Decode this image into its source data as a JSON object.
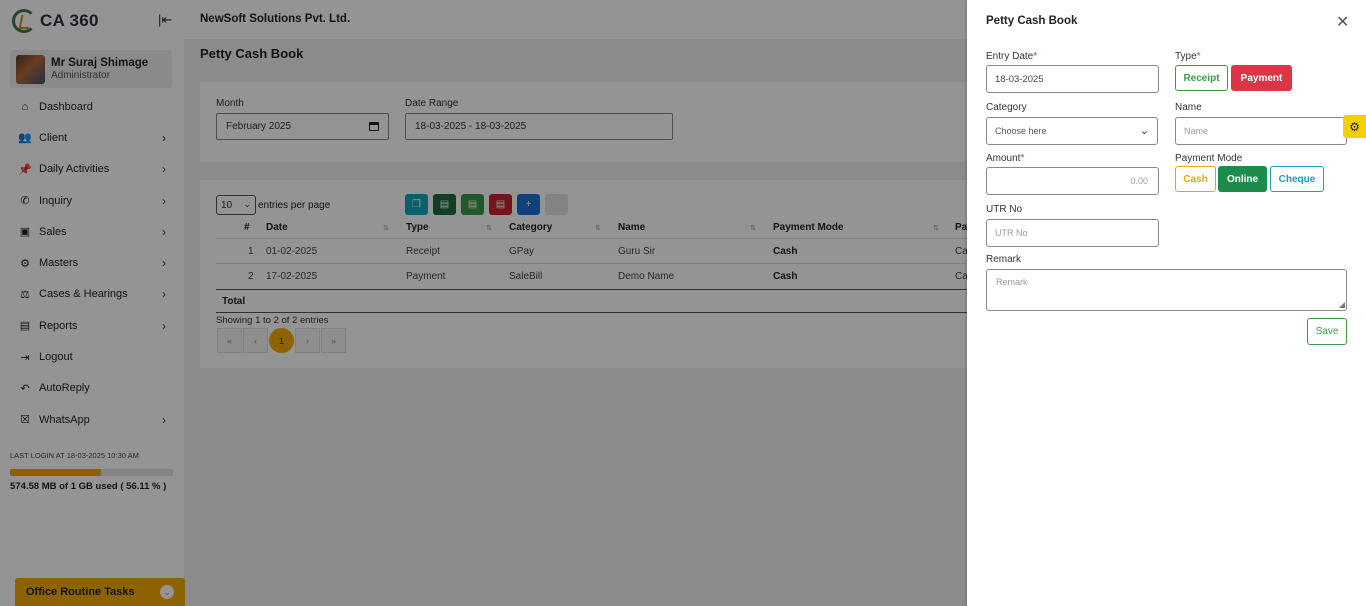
{
  "app": {
    "logo_text": "CA 360",
    "collapse_icon": "|⇤",
    "company": "NewSoft Solutions Pvt. Ltd.",
    "page_title": "Petty Cash Book"
  },
  "user": {
    "name": "Mr Suraj Shimage",
    "role": "Administrator"
  },
  "sidebar": {
    "items": [
      {
        "label": "Dashboard",
        "icon": "home-icon",
        "has_children": false
      },
      {
        "label": "Client",
        "icon": "users-icon",
        "has_children": true
      },
      {
        "label": "Daily Activities",
        "icon": "pin-icon",
        "has_children": true
      },
      {
        "label": "Inquiry",
        "icon": "phone-icon",
        "has_children": true
      },
      {
        "label": "Sales",
        "icon": "cash-register-icon",
        "has_children": true
      },
      {
        "label": "Masters",
        "icon": "cogs-icon",
        "has_children": true
      },
      {
        "label": "Cases & Hearings",
        "icon": "scale-icon",
        "has_children": true
      },
      {
        "label": "Reports",
        "icon": "file-icon",
        "has_children": true
      },
      {
        "label": "Logout",
        "icon": "logout-icon",
        "has_children": false
      },
      {
        "label": "AutoReply",
        "icon": "reply-icon",
        "has_children": false
      },
      {
        "label": "WhatsApp",
        "icon": "whatsapp-icon",
        "has_children": true
      }
    ],
    "chevron": "›",
    "last_login": "LAST LOGIN AT 18-03-2025 10:30 AM",
    "storage_used_fraction": 0.5611,
    "storage_text": "574.58 MB of 1 GB used ( 56.11 % )",
    "routine_label": "Office Routine Tasks"
  },
  "filters": {
    "month_label": "Month",
    "month_value": "February 2025",
    "range_label": "Date Range",
    "range_value": "18-03-2025 - 18-03-2025"
  },
  "table": {
    "page_size": "10",
    "entries_label": "entries per page",
    "columns": [
      "#",
      "Date",
      "Type",
      "Category",
      "Name",
      "Payment Mode",
      "Pa"
    ],
    "rows": [
      [
        "1",
        "01-02-2025",
        "Receipt",
        "GPay",
        "Guru Sir",
        "Cash",
        "Ca"
      ],
      [
        "2",
        "17-02-2025",
        "Payment",
        "SaleBill",
        "Demo Name",
        "Cash",
        "Ca"
      ]
    ],
    "total_label": "Total",
    "showing": "Showing 1 to 2 of 2 entries",
    "pagination": [
      "«",
      "‹",
      "1",
      "›",
      "»"
    ],
    "current_page": "1"
  },
  "drawer": {
    "title": "Petty Cash Book",
    "close": "✕",
    "entry_date_label": "Entry Date",
    "entry_date_value": "18-03-2025",
    "type_label": "Type",
    "type_options": [
      "Receipt",
      "Payment"
    ],
    "type_selected": "Payment",
    "category_label": "Category",
    "category_placeholder": "Choose here",
    "name_label": "Name",
    "name_placeholder": "Name",
    "amount_label": "Amount",
    "amount_placeholder": "0.00",
    "payment_mode_label": "Payment Mode",
    "payment_modes": [
      "Cash",
      "Online",
      "Cheque"
    ],
    "payment_mode_selected": "Online",
    "utr_label": "UTR No",
    "utr_placeholder": "UTR No",
    "remark_label": "Remark",
    "remark_placeholder": "Remark",
    "save_label": "Save",
    "required_mark": "*"
  },
  "colors": {
    "accent": "#f6aa00",
    "receipt": "#3a9a4a",
    "payment": "#dc3545",
    "online": "#1e8a4c",
    "cheque": "#17a2b8",
    "cash": "#e0a800"
  }
}
